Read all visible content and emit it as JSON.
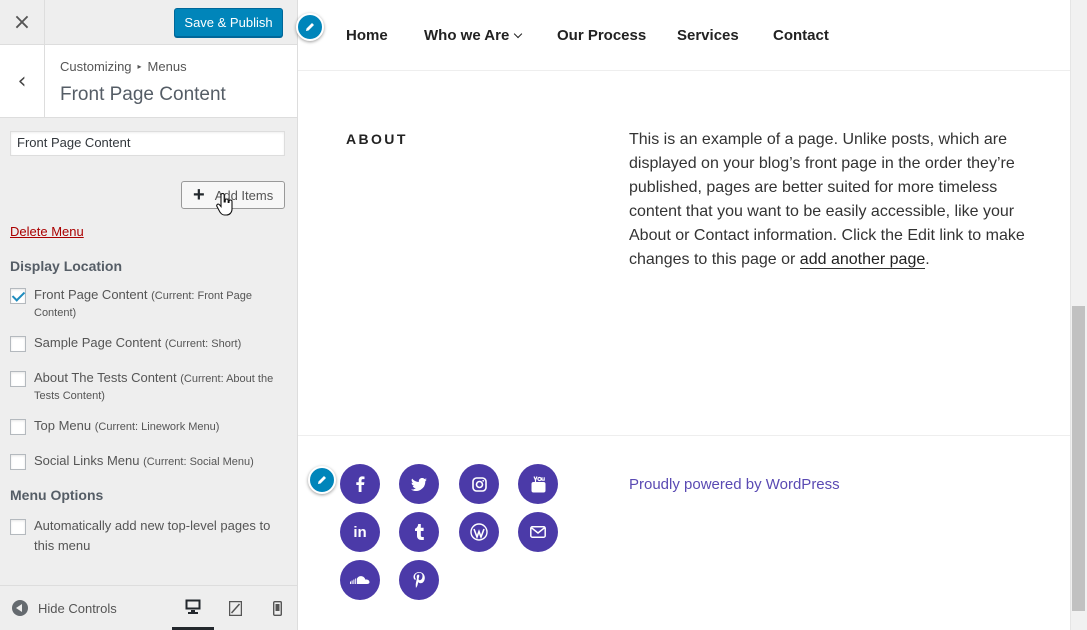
{
  "header": {
    "close_label": "×",
    "publish_label": "Save & Publish"
  },
  "section": {
    "back_label": "‹",
    "crumb_root": "Customizing",
    "crumb_sep": "▸",
    "crumb_leaf": "Menus",
    "title": "Front Page Content"
  },
  "menu": {
    "name_value": "Front Page Content",
    "add_items_label": "Add Items",
    "delete_label": "Delete Menu"
  },
  "display_location": {
    "title": "Display Location",
    "items": [
      {
        "label": "Front Page Content",
        "current": "(Current: Front Page Content)",
        "checked": true
      },
      {
        "label": "Sample Page Content",
        "current": "(Current: Short)",
        "checked": false
      },
      {
        "label": "About The Tests Content",
        "current": "(Current: About the Tests Content)",
        "checked": false
      },
      {
        "label": "Top Menu",
        "current": "(Current: Linework Menu)",
        "checked": false
      },
      {
        "label": "Social Links Menu",
        "current": "(Current: Social Menu)",
        "checked": false
      }
    ]
  },
  "menu_options": {
    "title": "Menu Options",
    "auto_add_label": "Automatically add new top-level pages to this menu",
    "auto_add_checked": false
  },
  "footer_controls": {
    "hide_label": "Hide Controls",
    "devices": [
      "desktop-icon",
      "tablet-icon",
      "mobile-icon"
    ],
    "active_device": "desktop"
  },
  "preview": {
    "nav": [
      "Home",
      "Who we Are",
      "Our Process",
      "Services",
      "Contact"
    ],
    "about_title": "ABOUT",
    "about_text": "This is an example of a page. Unlike posts, which are displayed on your blog’s front page in the order they’re published, pages are better suited for more timeless content that you want to be easily accessible, like your About or Contact information. Click the Edit link to make changes to this page or",
    "about_link": "add another page",
    "about_end": ".",
    "social_icons": [
      "facebook-icon",
      "twitter-icon",
      "instagram-icon",
      "youtube-icon",
      "linkedin-icon",
      "tumblr-icon",
      "wordpress-icon",
      "email-icon",
      "soundcloud-icon",
      "pinterest-icon"
    ],
    "powered_by": "Proudly powered by WordPress"
  },
  "colors": {
    "publish": "#0085ba",
    "social": "#4b3aa8",
    "delete": "#aa0000"
  }
}
